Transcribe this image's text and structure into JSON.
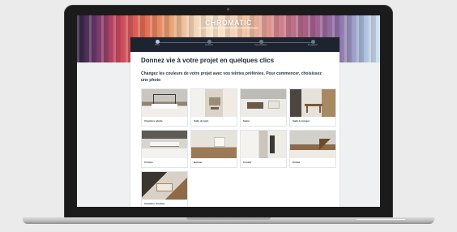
{
  "app": {
    "brand": "CHROMATIC"
  },
  "steps": [
    {
      "label": "Photo",
      "active": true
    },
    {
      "label": "Couleurs",
      "active": false
    },
    {
      "label": "Personnaliser",
      "active": false
    },
    {
      "label": "Enregistrer",
      "active": false
    }
  ],
  "main": {
    "title": "Donnez vie à votre projet en quelques clics",
    "subtitle": "Changez les couleurs de votre projet avec vos teintes préférées. Pour commencer, choisissez une photo"
  },
  "photos": [
    {
      "label": "Chambre adulte",
      "icon": "bedroom-photo"
    },
    {
      "label": "Salle de bain",
      "icon": "bathroom-photo"
    },
    {
      "label": "Salon",
      "icon": "living-room-photo"
    },
    {
      "label": "Salle à manger",
      "icon": "dining-room-photo"
    },
    {
      "label": "Cuisine",
      "icon": "kitchen-photo"
    },
    {
      "label": "Bureau",
      "icon": "office-photo"
    },
    {
      "label": "Couloir",
      "icon": "hallway-photo"
    },
    {
      "label": "Entrée",
      "icon": "entrance-photo"
    },
    {
      "label": "Chambre d'enfant",
      "icon": "kids-room-photo"
    }
  ],
  "colors": {
    "stepbar": "#1d2430",
    "laptop": "#1b1b1c",
    "panel": "#ffffff"
  }
}
